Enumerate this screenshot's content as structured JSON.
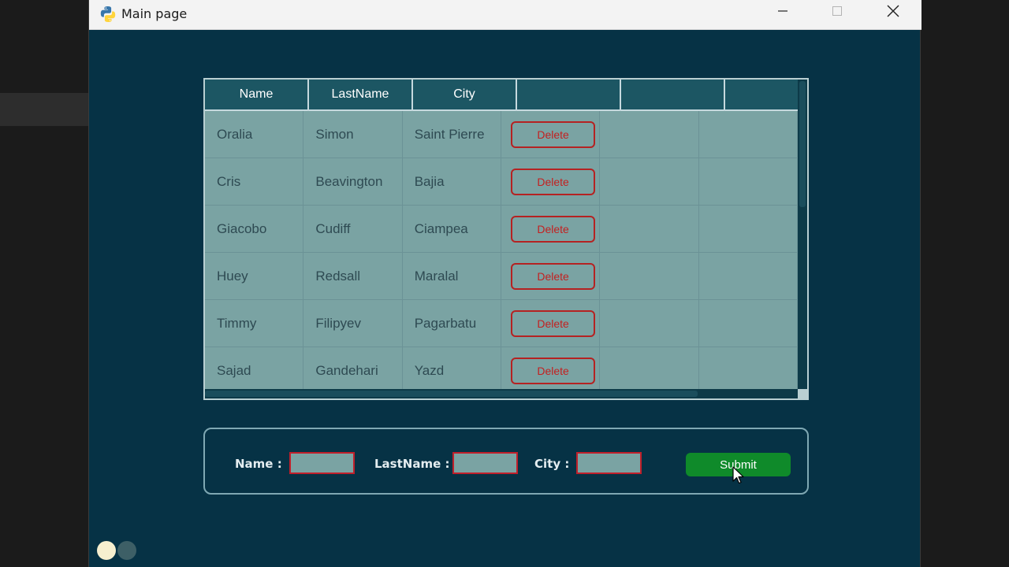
{
  "window": {
    "title": "Main page",
    "app_icon": "python-icon",
    "controls": [
      "minimize-icon",
      "maximize-icon",
      "close-icon"
    ]
  },
  "table": {
    "columns": [
      "Name",
      "LastName",
      "City",
      "",
      "",
      ""
    ],
    "rows": [
      {
        "name": "Oralia",
        "lastname": "Simon",
        "city": "Saint Pierre",
        "action": "Delete"
      },
      {
        "name": "Cris",
        "lastname": "Beavington",
        "city": "Bajia",
        "action": "Delete"
      },
      {
        "name": "Giacobo",
        "lastname": "Cudiff",
        "city": "Ciampea",
        "action": "Delete"
      },
      {
        "name": "Huey",
        "lastname": "Redsall",
        "city": "Maralal",
        "action": "Delete"
      },
      {
        "name": "Timmy",
        "lastname": "Filipyev",
        "city": "Pagarbatu",
        "action": "Delete"
      },
      {
        "name": "Sajad",
        "lastname": "Gandehari",
        "city": "Yazd",
        "action": "Delete"
      }
    ]
  },
  "form": {
    "name_label": "Name :",
    "name_value": "",
    "lastname_label": "LastName :",
    "lastname_value": "",
    "city_label": "City :",
    "city_value": "",
    "submit_label": "Submit"
  },
  "colors": {
    "window_bg": "#063245",
    "table_bg": "#7aa3a3",
    "header_bg": "#1c5663",
    "delete_border": "#b52222",
    "submit_bg": "#0f8a2a"
  }
}
